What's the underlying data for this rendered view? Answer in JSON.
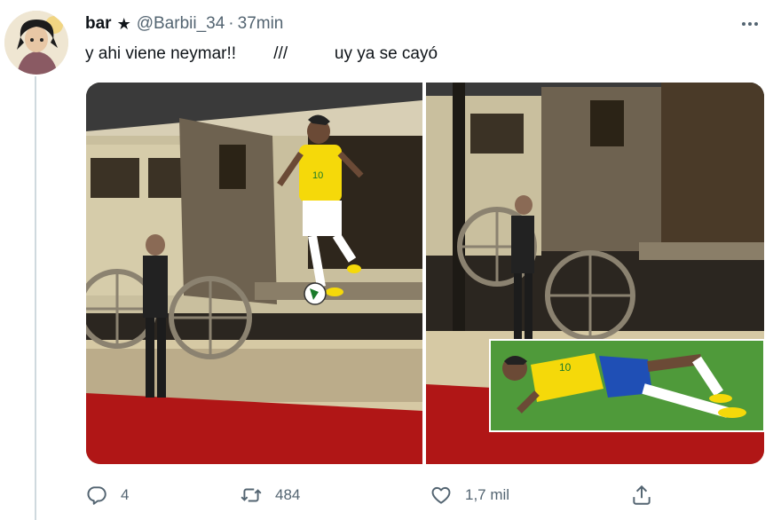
{
  "tweet": {
    "display_name": "bar",
    "badge": "★",
    "handle": "@Barbii_34",
    "separator": "·",
    "time": "37min",
    "text": "y ahi viene neymar!!        ///          uy ya se cayó"
  },
  "media": {
    "panels": [
      {
        "name": "carriage-scene-jump",
        "description_icon": "image"
      },
      {
        "name": "carriage-scene-fall",
        "description_icon": "image"
      }
    ]
  },
  "actions": {
    "reply_count": "4",
    "retweet_count": "484",
    "like_count": "1,7 mil"
  },
  "colors": {
    "secondary_text": "#536471",
    "jersey_yellow": "#f5d90a",
    "shorts_blue": "#1f4fb5",
    "carpet_red": "#b01616",
    "grass_green": "#4f9a3a"
  }
}
